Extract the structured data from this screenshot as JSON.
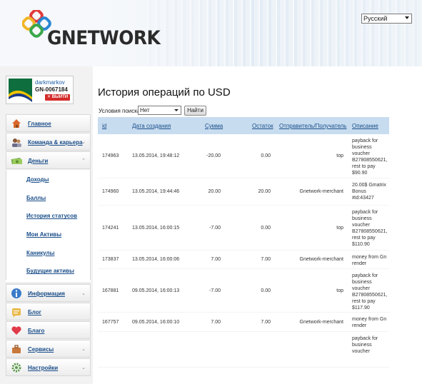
{
  "header": {
    "logo_text": "GNETWORK",
    "language": "Русский"
  },
  "user": {
    "name": "darkmarkov",
    "id": "GN-0067184",
    "logout": "✕ ВЫЙТИ"
  },
  "menu": [
    {
      "label": "Главное",
      "icon": "home-icon",
      "chevron": ""
    },
    {
      "label": "Команда & карьера",
      "icon": "team-icon",
      "chevron": "⌄"
    },
    {
      "label": "Деньги",
      "icon": "money-icon",
      "chevron": "⌃"
    },
    {
      "label": "Информация",
      "icon": "info-icon",
      "chevron": "⌄"
    },
    {
      "label": "Блог",
      "icon": "blog-icon",
      "chevron": ""
    },
    {
      "label": "Благо",
      "icon": "charity-icon",
      "chevron": ""
    },
    {
      "label": "Сервисы",
      "icon": "services-icon",
      "chevron": "⌄"
    },
    {
      "label": "Настройки",
      "icon": "settings-icon",
      "chevron": "⌄"
    }
  ],
  "submenu": [
    "Доходы",
    "Баллы",
    "История статусов",
    "Мои Активы",
    "Каникулы",
    "Будущие активы"
  ],
  "page": {
    "title": "История операций по USD",
    "filter_label": "Условия поиска",
    "filter_value": "Нет",
    "find_button": "Найти"
  },
  "table": {
    "columns": [
      "id",
      "Дата создания",
      "Сумма",
      "Остаток",
      "Отправитель/Получатель",
      "Описание"
    ],
    "rows": [
      {
        "id": "174963",
        "date": "13.05.2014, 19:48:12",
        "amount": "-20.00",
        "balance": "0.00",
        "party": "top",
        "desc": "payback for business voucher B27808550621, rest to pay $90.90"
      },
      {
        "id": "174960",
        "date": "13.05.2014, 19:44:46",
        "amount": "20.00",
        "balance": "20.00",
        "party": "Gnetwork-merchant",
        "desc": "20.00$ Gmatrix Bonus #id:43427"
      },
      {
        "id": "174241",
        "date": "13.05.2014, 16:00:15",
        "amount": "-7.00",
        "balance": "0.00",
        "party": "top",
        "desc": "payback for business voucher B27808550621, rest to pay $110.90"
      },
      {
        "id": "173837",
        "date": "13.05.2014, 16:00:06",
        "amount": "7.00",
        "balance": "7.00",
        "party": "Gnetwork-merchant",
        "desc": "money from Gn render"
      },
      {
        "id": "167881",
        "date": "09.05.2014, 16:00:13",
        "amount": "-7.00",
        "balance": "0.00",
        "party": "top",
        "desc": "payback for business voucher B27808550621, rest to pay $117.90"
      },
      {
        "id": "167757",
        "date": "09.05.2014, 16:00:10",
        "amount": "7.00",
        "balance": "7.00",
        "party": "Gnetwork-merchant",
        "desc": "money from Gn render"
      },
      {
        "id": "",
        "date": "",
        "amount": "",
        "balance": "",
        "party": "",
        "desc": "payback for business voucher"
      }
    ]
  }
}
